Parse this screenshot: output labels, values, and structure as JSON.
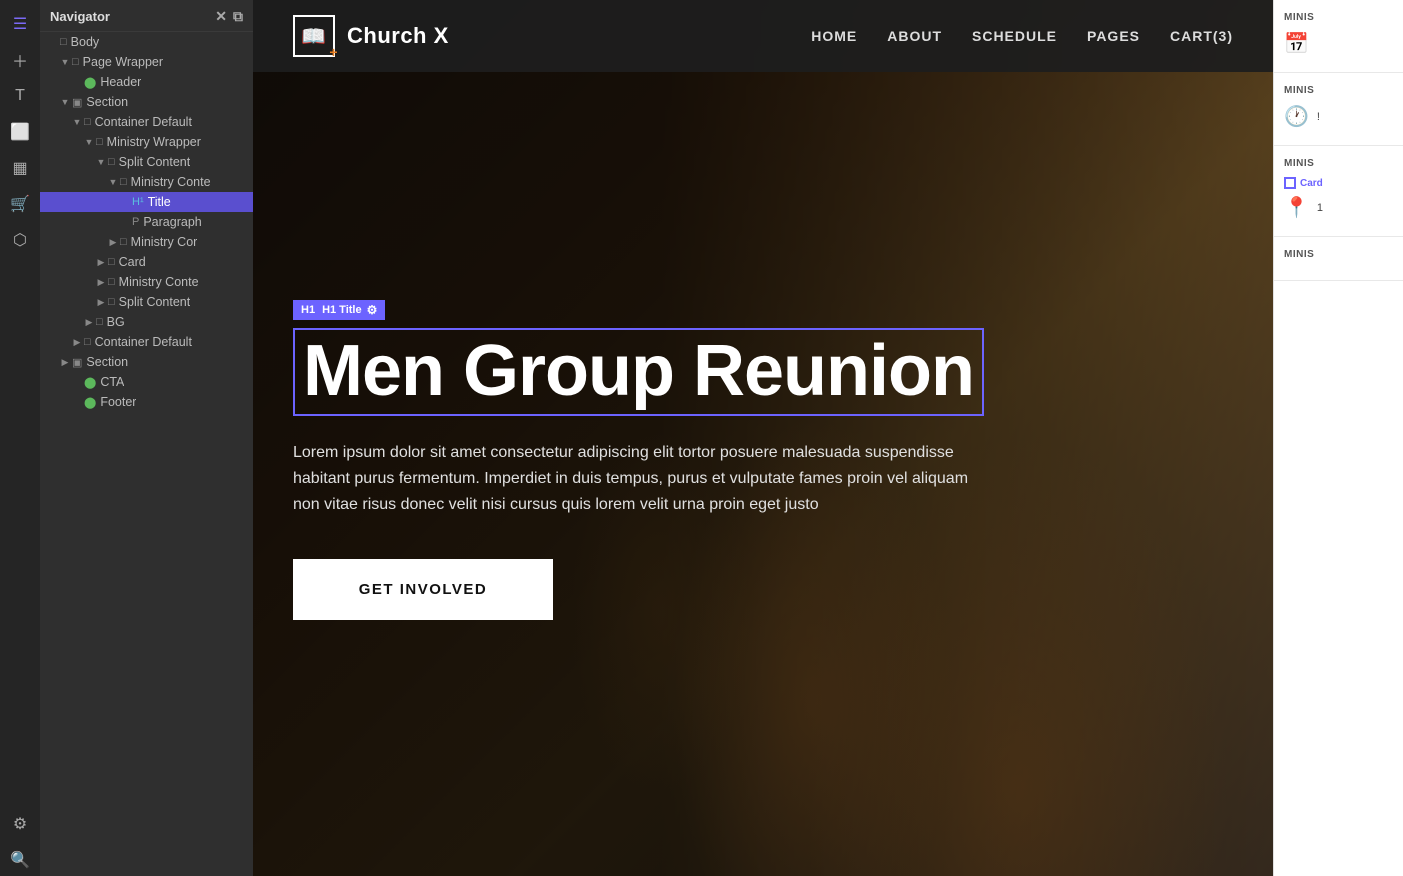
{
  "sidebar": {
    "title": "Navigator",
    "tree": [
      {
        "id": "body",
        "label": "Body",
        "level": 0,
        "arrow": false,
        "icon": "□",
        "iconClass": ""
      },
      {
        "id": "page-wrapper",
        "label": "Page Wrapper",
        "level": 1,
        "arrow": true,
        "arrowDir": "down",
        "icon": "□",
        "iconClass": ""
      },
      {
        "id": "header",
        "label": "Header",
        "level": 2,
        "arrow": false,
        "icon": "⬤",
        "iconClass": "green"
      },
      {
        "id": "section1",
        "label": "Section",
        "level": 1,
        "arrow": true,
        "arrowDir": "down",
        "icon": "▣",
        "iconClass": ""
      },
      {
        "id": "container-default",
        "label": "Container Default",
        "level": 2,
        "arrow": true,
        "arrowDir": "down",
        "icon": "□",
        "iconClass": ""
      },
      {
        "id": "ministry-wrapper",
        "label": "Ministry Wrapper",
        "level": 3,
        "arrow": true,
        "arrowDir": "down",
        "icon": "□",
        "iconClass": ""
      },
      {
        "id": "split-content",
        "label": "Split Content",
        "level": 4,
        "arrow": true,
        "arrowDir": "down",
        "icon": "□",
        "iconClass": ""
      },
      {
        "id": "ministry-conte-1",
        "label": "Ministry Conte",
        "level": 5,
        "arrow": true,
        "arrowDir": "down",
        "icon": "□",
        "iconClass": ""
      },
      {
        "id": "title",
        "label": "Title",
        "level": 6,
        "arrow": false,
        "icon": "H¹",
        "iconClass": "blue",
        "selected": true
      },
      {
        "id": "paragraph",
        "label": "Paragraph",
        "level": 6,
        "arrow": false,
        "icon": "P",
        "iconClass": ""
      },
      {
        "id": "ministry-cor",
        "label": "Ministry Cor",
        "level": 5,
        "arrow": true,
        "arrowDir": "right",
        "icon": "□",
        "iconClass": ""
      },
      {
        "id": "card",
        "label": "Card",
        "level": 4,
        "arrow": true,
        "arrowDir": "right",
        "icon": "□",
        "iconClass": ""
      },
      {
        "id": "ministry-conte-2",
        "label": "Ministry Conte",
        "level": 4,
        "arrow": true,
        "arrowDir": "right",
        "icon": "□",
        "iconClass": ""
      },
      {
        "id": "split-content-2",
        "label": "Split Content",
        "level": 4,
        "arrow": true,
        "arrowDir": "right",
        "icon": "□",
        "iconClass": ""
      },
      {
        "id": "bg",
        "label": "BG",
        "level": 3,
        "arrow": true,
        "arrowDir": "right",
        "icon": "□",
        "iconClass": ""
      },
      {
        "id": "container-default-2",
        "label": "Container Default",
        "level": 2,
        "arrow": true,
        "arrowDir": "right",
        "icon": "□",
        "iconClass": ""
      },
      {
        "id": "section2",
        "label": "Section",
        "level": 1,
        "arrow": true,
        "arrowDir": "right",
        "icon": "▣",
        "iconClass": ""
      },
      {
        "id": "cta",
        "label": "CTA",
        "level": 2,
        "arrow": false,
        "icon": "⬤",
        "iconClass": "green"
      },
      {
        "id": "footer",
        "label": "Footer",
        "level": 2,
        "arrow": false,
        "icon": "⬤",
        "iconClass": "green"
      }
    ]
  },
  "icons_sidebar": [
    {
      "id": "layers-icon",
      "symbol": "☰",
      "active": true
    },
    {
      "id": "add-icon",
      "symbol": "＋",
      "active": false
    },
    {
      "id": "text-icon",
      "symbol": "T",
      "active": false
    },
    {
      "id": "pages-icon",
      "symbol": "⬜",
      "active": false
    },
    {
      "id": "blocks-icon",
      "symbol": "▦",
      "active": false
    },
    {
      "id": "cart-icon",
      "symbol": "🛒",
      "active": false
    },
    {
      "id": "media-icon",
      "symbol": "⬡",
      "active": false
    },
    {
      "id": "settings-icon",
      "symbol": "⚙",
      "active": false
    },
    {
      "id": "search-icon2",
      "symbol": "🔍",
      "active": false
    }
  ],
  "nav": {
    "logo_icon": "📖",
    "logo_text": "Church X",
    "links": [
      "HOME",
      "ABOUT",
      "SCHEDULE",
      "PAGES",
      "CART(3)"
    ]
  },
  "hero": {
    "title_badge": "H1  Title",
    "title": "Men Group Reunion",
    "description": "Lorem ipsum dolor sit amet consectetur adipiscing elit tortor posuere malesuada suspendisse habitant purus fermentum. Imperdiet in duis tempus, purus et vulputate fames proin vel aliquam non vitae risus donec velit nisi cursus quis lorem velit urna proin eget justo",
    "cta_button": "GET INVOLVED"
  },
  "right_panel": {
    "sections": [
      {
        "id": "rp-section-1",
        "label": "MINIS",
        "icon": "📅",
        "icon_name": "calendar-icon",
        "text": ""
      },
      {
        "id": "rp-section-2",
        "label": "MINIS",
        "icon": "🕐",
        "icon_name": "clock-icon",
        "text": "!"
      },
      {
        "id": "rp-section-3",
        "label": "MINIS",
        "card_label": "Card",
        "icon": "📍",
        "icon_name": "location-icon",
        "text": "1"
      },
      {
        "id": "rp-section-4",
        "label": "MINIS",
        "icon": "",
        "icon_name": "",
        "text": ""
      }
    ]
  },
  "colors": {
    "accent": "#6c63ff",
    "nav_bg": "rgba(20,20,20,0.95)",
    "sidebar_bg": "#2f2f2f",
    "selected_bg": "#5a4fcf"
  }
}
